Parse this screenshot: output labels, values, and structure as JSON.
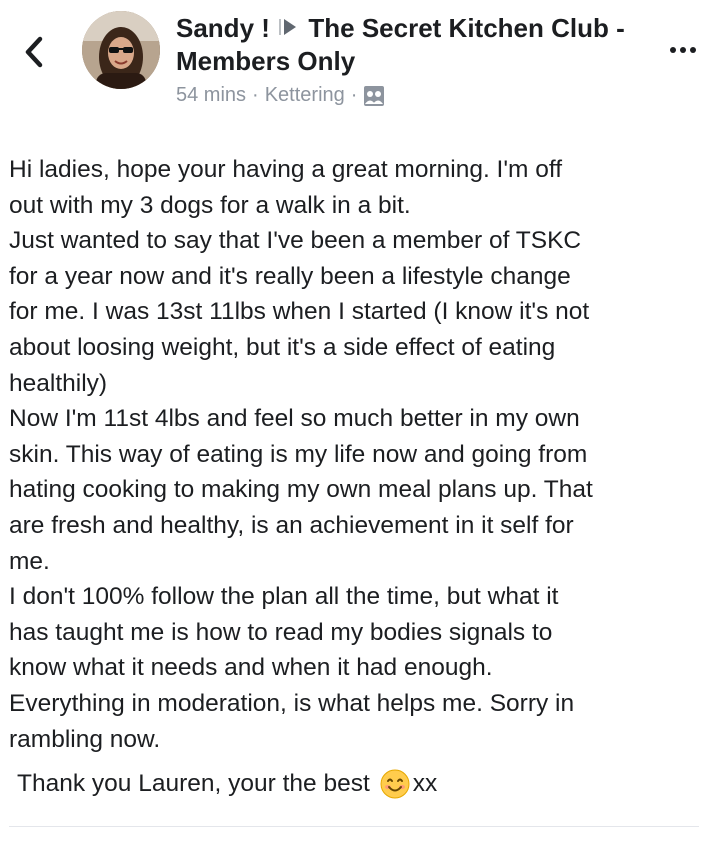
{
  "header": {
    "author": "Sandy !",
    "group": "The Secret Kitchen Club - Members Only",
    "time": "54 mins",
    "location": "Kettering",
    "separator": "·"
  },
  "post": {
    "lines": [
      "Hi ladies, hope your having a great morning. I'm off",
      "out with my 3 dogs for a walk in a bit.",
      "Just wanted to say that I've been a member of TSKC",
      "for a year now and it's really been a lifestyle change",
      "for me. I was 13st 11lbs when I started (I know it's not",
      "about loosing weight, but it's a side effect of eating",
      "healthily)",
      "Now I'm 11st 4lbs and feel so much better in my own",
      "skin. This way of eating is my life now and going from",
      "hating cooking to making my own meal plans up. That",
      "are fresh and healthy, is an achievement in it self for",
      "me.",
      "I don't 100% follow the plan all the time, but what it",
      "has taught me is how to read my bodies signals to",
      "know what it needs and when it had enough.",
      "Everything in moderation, is what helps me. Sorry in",
      "rambling now."
    ],
    "thanks": "Thank you Lauren, your the best",
    "thanks_suffix": "xx"
  },
  "icons": {
    "back": "chevron-left-icon",
    "privacy": "group-members-icon",
    "more": "more-horizontal-icon",
    "emoji": "smiling-face-emoji"
  }
}
